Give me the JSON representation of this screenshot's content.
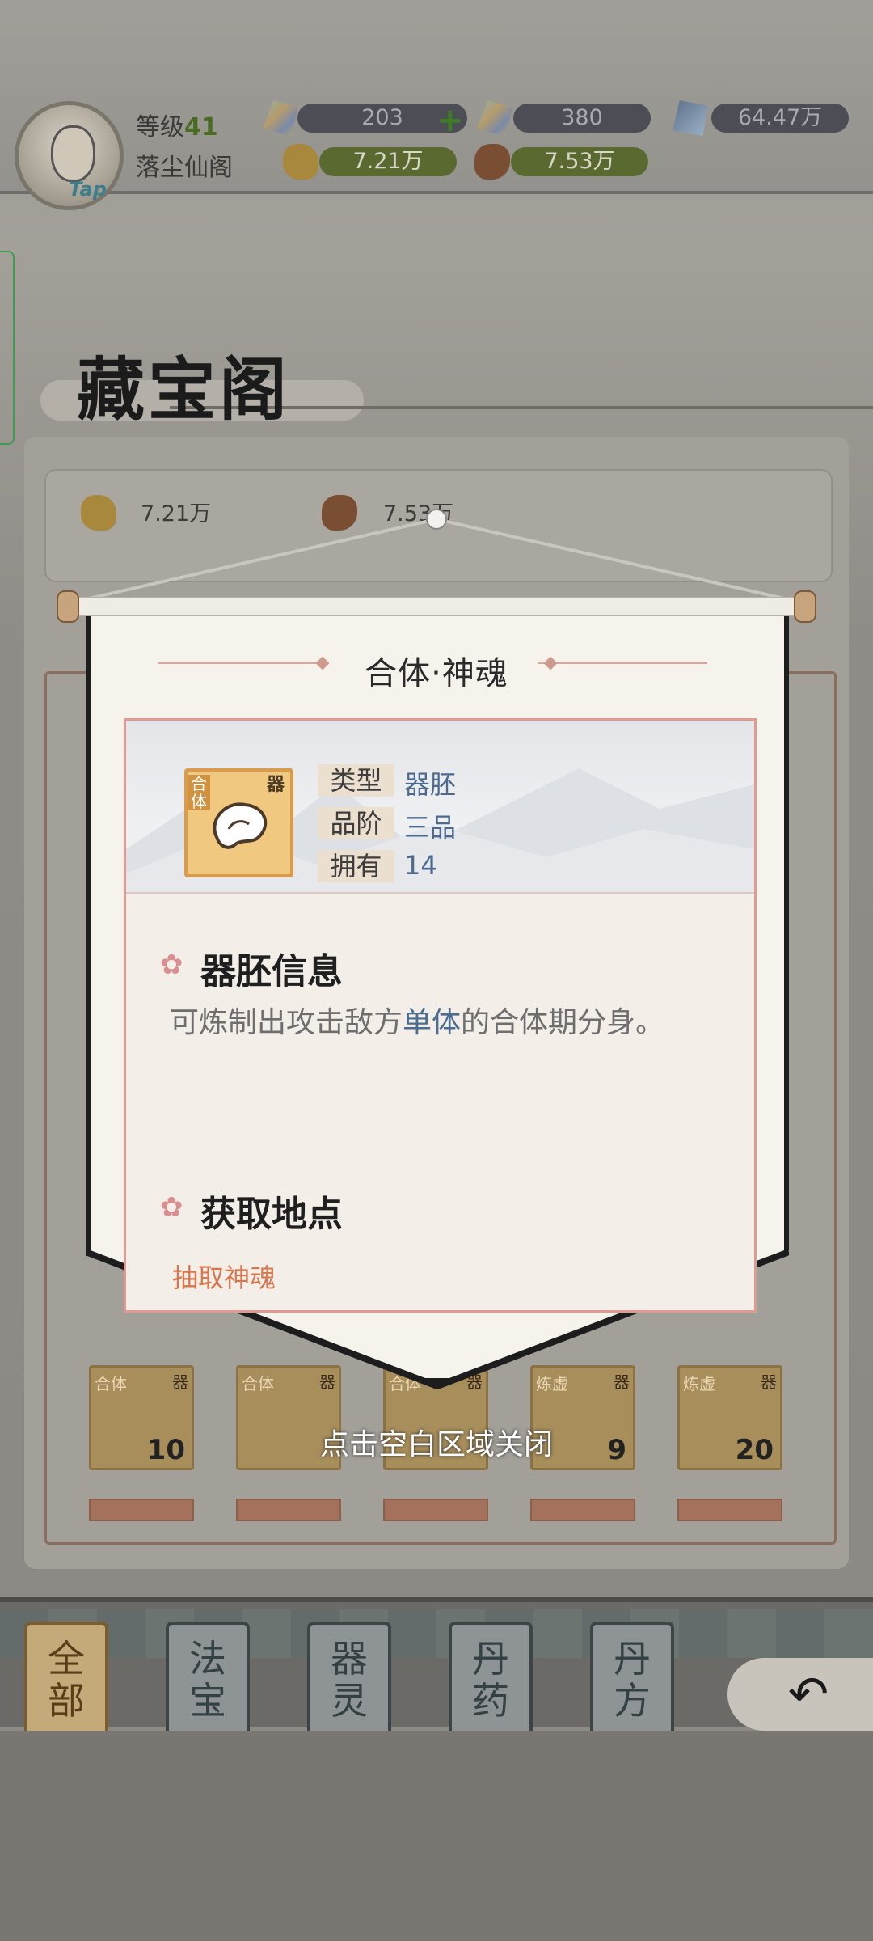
{
  "player": {
    "level_label": "等级",
    "level": "41",
    "sect_name": "落尘仙阁",
    "tap_label": "Tap"
  },
  "resources": {
    "gem_multi": "203",
    "gem_multi2": "380",
    "gem_blue": "64.47万",
    "ore_gold": "7.21万",
    "ore_brown": "7.53万"
  },
  "page": {
    "title": "藏宝阁",
    "ore_gold": "7.21万",
    "ore_brown": "7.53万"
  },
  "grid_items": [
    {
      "tag": "合体",
      "tag2": "器",
      "count": "10"
    },
    {
      "tag": "合体",
      "tag2": "器",
      "count": ""
    },
    {
      "tag": "合体",
      "tag2": "器",
      "count": ""
    },
    {
      "tag": "炼虚",
      "tag2": "器",
      "count": "9"
    },
    {
      "tag": "炼虚",
      "tag2": "器",
      "count": "20"
    }
  ],
  "tabs": [
    {
      "label": "全部",
      "active": true
    },
    {
      "label": "法宝",
      "active": false
    },
    {
      "label": "器灵",
      "active": false
    },
    {
      "label": "丹药",
      "active": false
    },
    {
      "label": "丹方",
      "active": false
    }
  ],
  "modal": {
    "title": "合体·神魂",
    "item_tag_left": "合体",
    "item_tag_right": "器",
    "attrs": [
      {
        "label": "类型",
        "value": "器胚"
      },
      {
        "label": "品阶",
        "value": "三品"
      },
      {
        "label": "拥有",
        "value": "14"
      }
    ],
    "info_section": "器胚信息",
    "desc_before": "可炼制出攻击敌方",
    "desc_highlight": "单体",
    "desc_after": "的合体期分身。",
    "source_section": "获取地点",
    "source_link": "抽取神魂"
  },
  "close_hint": "点击空白区域关闭",
  "colors": {
    "accent_green": "#4a6b22",
    "modal_border": "#e09a92",
    "link_orange": "#d7774e",
    "highlight_blue": "#4a6d92"
  },
  "icons": {
    "back": "return-arrow-icon",
    "section": "flower-icon",
    "item": "spirit-orb-icon"
  }
}
